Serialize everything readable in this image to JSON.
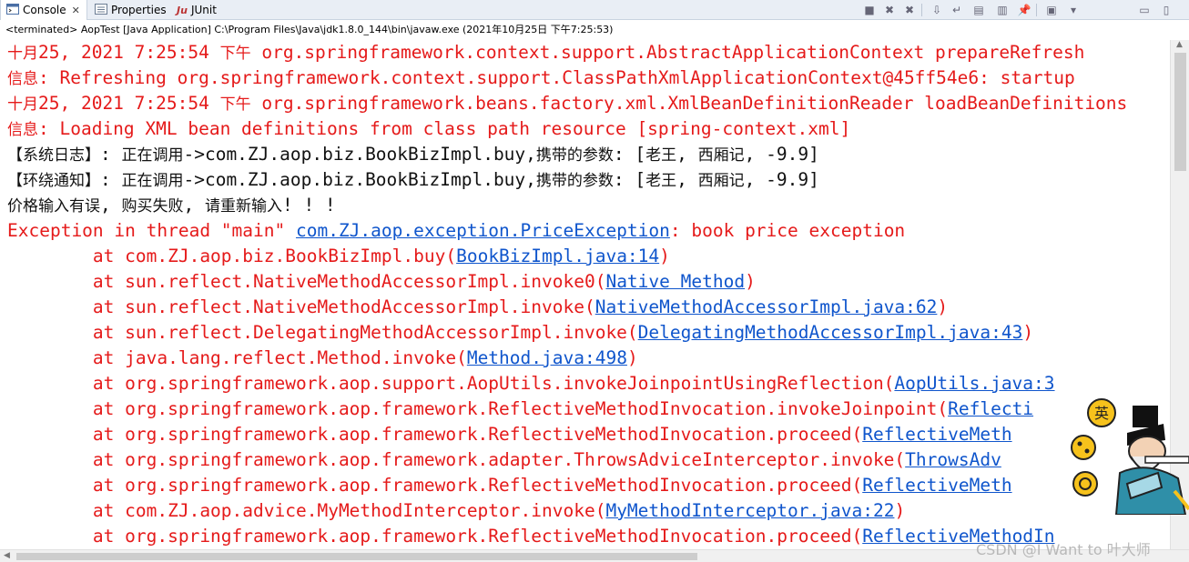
{
  "tabs": [
    {
      "label": "Console",
      "icon": "console-icon",
      "close": "✕"
    },
    {
      "label": "Properties",
      "icon": "properties-icon"
    },
    {
      "label": "JUnit",
      "icon": "junit-icon",
      "icon_text": "Ju"
    }
  ],
  "toolbar": {
    "buttons": [
      "terminate-icon",
      "remove-launch-icon",
      "remove-all-icon",
      "scroll-lock-icon",
      "word-wrap-icon",
      "show-stdout-icon",
      "show-stderr-icon",
      "pin-console-icon",
      "display-console-icon",
      "open-console-icon",
      "minimize-icon",
      "maximize-icon"
    ],
    "glyphs": [
      "■",
      "✖",
      "✖",
      "⇩",
      "↵",
      "▤",
      "▥",
      "📌",
      "▣",
      "▾",
      "▭",
      "▯"
    ]
  },
  "status": "<terminated> AopTest [Java Application] C:\\Program Files\\Java\\jdk1.8.0_144\\bin\\javaw.exe (2021年10月25日 下午7:25:53)",
  "console": {
    "lines": [
      {
        "cls": "red",
        "a": "十月25, 2021 7:25:54 下午 org.springframework.context.support.AbstractApplicationContext prepareRefresh"
      },
      {
        "cls": "red",
        "a": "信息: Refreshing org.springframework.context.support.ClassPathXmlApplicationContext@45ff54e6: startup"
      },
      {
        "cls": "red",
        "a": "十月25, 2021 7:25:54 下午 org.springframework.beans.factory.xml.XmlBeanDefinitionReader loadBeanDefinitions"
      },
      {
        "cls": "red",
        "a": "信息: Loading XML bean definitions from class path resource [spring-context.xml]"
      },
      {
        "cls": "blk",
        "a": "【系统日志】: 正在调用->com.ZJ.aop.biz.BookBizImpl.buy,携带的参数: [老王, 西厢记, -9.9]"
      },
      {
        "cls": "blk",
        "a": "【环绕通知】: 正在调用->com.ZJ.aop.biz.BookBizImpl.buy,携带的参数: [老王, 西厢记, -9.9]"
      },
      {
        "cls": "blk",
        "a": "价格输入有误, 购买失败, 请重新输入! ! !"
      },
      {
        "cls": "red",
        "a": "Exception in thread \"main\" ",
        "link": "com.ZJ.aop.exception.PriceException",
        "b": ": book price exception"
      },
      {
        "cls": "red",
        "a": "        at com.ZJ.aop.biz.BookBizImpl.buy(",
        "link": "BookBizImpl.java:14",
        "b": ")"
      },
      {
        "cls": "red",
        "a": "        at sun.reflect.NativeMethodAccessorImpl.invoke0(",
        "link": "Native Method",
        "b": ")"
      },
      {
        "cls": "red",
        "a": "        at sun.reflect.NativeMethodAccessorImpl.invoke(",
        "link": "NativeMethodAccessorImpl.java:62",
        "b": ")"
      },
      {
        "cls": "red",
        "a": "        at sun.reflect.DelegatingMethodAccessorImpl.invoke(",
        "link": "DelegatingMethodAccessorImpl.java:43",
        "b": ")"
      },
      {
        "cls": "red",
        "a": "        at java.lang.reflect.Method.invoke(",
        "link": "Method.java:498",
        "b": ")"
      },
      {
        "cls": "red",
        "a": "        at org.springframework.aop.support.AopUtils.invokeJoinpointUsingReflection(",
        "link": "AopUtils.java:3",
        "b": ""
      },
      {
        "cls": "red",
        "a": "        at org.springframework.aop.framework.ReflectiveMethodInvocation.invokeJoinpoint(",
        "link": "Reflecti",
        "b": ""
      },
      {
        "cls": "red",
        "a": "        at org.springframework.aop.framework.ReflectiveMethodInvocation.proceed(",
        "link": "ReflectiveMeth",
        "b": ""
      },
      {
        "cls": "red",
        "a": "        at org.springframework.aop.framework.adapter.ThrowsAdviceInterceptor.invoke(",
        "link": "ThrowsAdv",
        "b": ""
      },
      {
        "cls": "red",
        "a": "        at org.springframework.aop.framework.ReflectiveMethodInvocation.proceed(",
        "link": "ReflectiveMeth",
        "b": ""
      },
      {
        "cls": "red",
        "a": "        at com.ZJ.aop.advice.MyMethodInterceptor.invoke(",
        "link": "MyMethodInterceptor.java:22",
        "b": ")"
      },
      {
        "cls": "red",
        "a": "        at org.springframework.aop.framework.ReflectiveMethodInvocation.proceed(",
        "link": "ReflectiveMethodIn",
        "b": ""
      }
    ]
  },
  "watermark": "CSDN @I Want to 叶大师",
  "badge": "英"
}
